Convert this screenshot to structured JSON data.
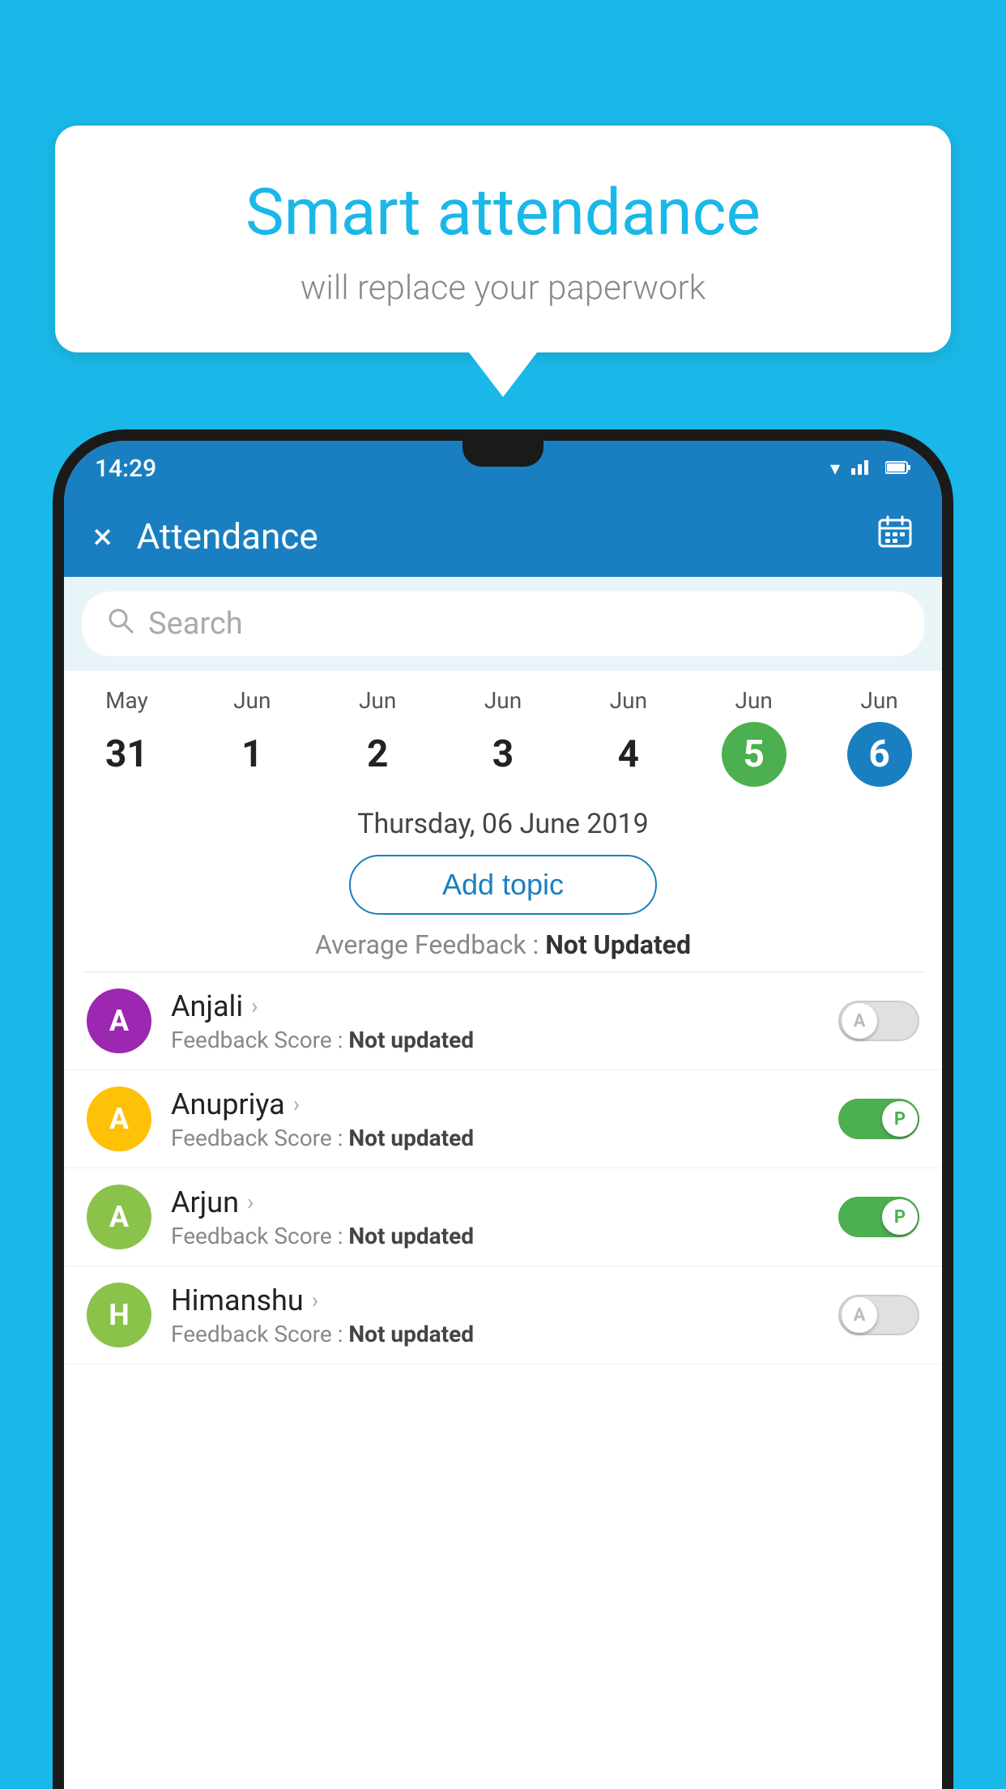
{
  "background_color": "#1ab8e8",
  "speech_bubble": {
    "title": "Smart attendance",
    "subtitle": "will replace your paperwork"
  },
  "status_bar": {
    "time": "14:29",
    "wifi_icon": "wifi",
    "signal_icon": "signal",
    "battery_icon": "battery"
  },
  "app_header": {
    "title": "Attendance",
    "close_label": "×",
    "calendar_icon": "calendar"
  },
  "search": {
    "placeholder": "Search"
  },
  "calendar": {
    "days": [
      {
        "month": "May",
        "date": "31",
        "state": "normal"
      },
      {
        "month": "Jun",
        "date": "1",
        "state": "normal"
      },
      {
        "month": "Jun",
        "date": "2",
        "state": "normal"
      },
      {
        "month": "Jun",
        "date": "3",
        "state": "normal"
      },
      {
        "month": "Jun",
        "date": "4",
        "state": "normal"
      },
      {
        "month": "Jun",
        "date": "5",
        "state": "today"
      },
      {
        "month": "Jun",
        "date": "6",
        "state": "selected"
      }
    ]
  },
  "selected_date": "Thursday, 06 June 2019",
  "add_topic_label": "Add topic",
  "avg_feedback_label": "Average Feedback :",
  "avg_feedback_value": "Not Updated",
  "students": [
    {
      "name": "Anjali",
      "avatar_letter": "A",
      "avatar_color": "#9c27b0",
      "feedback_label": "Feedback Score :",
      "feedback_value": "Not updated",
      "toggle_state": "off",
      "toggle_letter": "A"
    },
    {
      "name": "Anupriya",
      "avatar_letter": "A",
      "avatar_color": "#ffc107",
      "feedback_label": "Feedback Score :",
      "feedback_value": "Not updated",
      "toggle_state": "on",
      "toggle_letter": "P"
    },
    {
      "name": "Arjun",
      "avatar_letter": "A",
      "avatar_color": "#8bc34a",
      "feedback_label": "Feedback Score :",
      "feedback_value": "Not updated",
      "toggle_state": "on",
      "toggle_letter": "P"
    },
    {
      "name": "Himanshu",
      "avatar_letter": "H",
      "avatar_color": "#8bc34a",
      "feedback_label": "Feedback Score :",
      "feedback_value": "Not updated",
      "toggle_state": "off",
      "toggle_letter": "A"
    }
  ]
}
